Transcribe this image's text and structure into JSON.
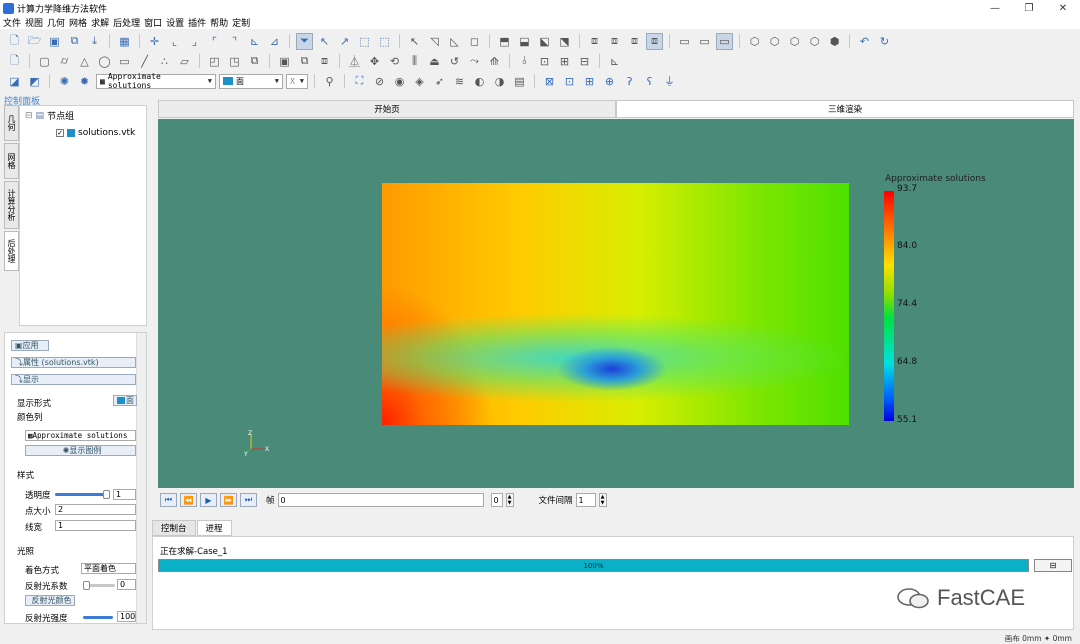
{
  "app": {
    "title": "计算力学降维方法软件"
  },
  "window_controls": {
    "minimize": "—",
    "restore": "❐",
    "close": "✕"
  },
  "menu": [
    "文件",
    "视图",
    "几何",
    "网格",
    "求解",
    "后处理",
    "窗口",
    "设置",
    "插件",
    "帮助",
    "定制"
  ],
  "toolbar3": {
    "field_select": "Approximate solutions",
    "render_select": "面",
    "component_select": "X"
  },
  "control_panel": {
    "title": "控制面板"
  },
  "side_tabs": [
    "几何",
    "网格",
    "计算分析",
    "后处理"
  ],
  "tree": {
    "group": "节点组",
    "item": "solutions.vtk"
  },
  "props": {
    "apply": "应用",
    "attributes": "属性 (solutions.vtk)",
    "display": "显示",
    "display_form_label": "显示形式",
    "display_form_value": "面",
    "color_label": "颜色列",
    "color_value": "Approximate solutions",
    "legend_button": "显示图例",
    "style_header": "样式",
    "opacity_label": "透明度",
    "opacity_value": "1",
    "opacity_level": 1.0,
    "point_size_label": "点大小",
    "point_size_value": "2",
    "line_width_label": "线宽",
    "line_width_value": "1",
    "lighting_header": "光照",
    "shading_label": "着色方式",
    "shading_value": "平面着色",
    "reflect_label": "反射光系数",
    "reflect_value": "0",
    "reflect_level": 0,
    "reflect_color_button": "反射光颜色",
    "reflect_intensity_label": "反射光强度",
    "reflect_intensity_value": "100",
    "reflect_intensity_level": 1.0
  },
  "view_tabs": [
    "开始页",
    "三维渲染"
  ],
  "colorbar": {
    "title": "Approximate solutions",
    "ticks": [
      "93.7",
      "84.0",
      "74.4",
      "64.8",
      "55.1"
    ],
    "max": 93.7,
    "min": 55.1,
    "colors": [
      "#ff0000",
      "#ffe000",
      "#00e040",
      "#00e0e0",
      "#0000e0"
    ]
  },
  "axes": {
    "x": "X",
    "y": "Y",
    "z": "Z"
  },
  "animation": {
    "frame_label": "帧",
    "frame_value": "0",
    "frame_index": "0",
    "interval_label": "文件间隔",
    "interval_value": "1"
  },
  "bottom_tabs": [
    "控制台",
    "进程"
  ],
  "process": {
    "status": "正在求解-Case_1",
    "progress_text": "100%",
    "progress": 1.0
  },
  "watermark": {
    "text": "FastCAE"
  },
  "statusbar": {
    "text": "画布 0mm ✦ 0mm"
  }
}
